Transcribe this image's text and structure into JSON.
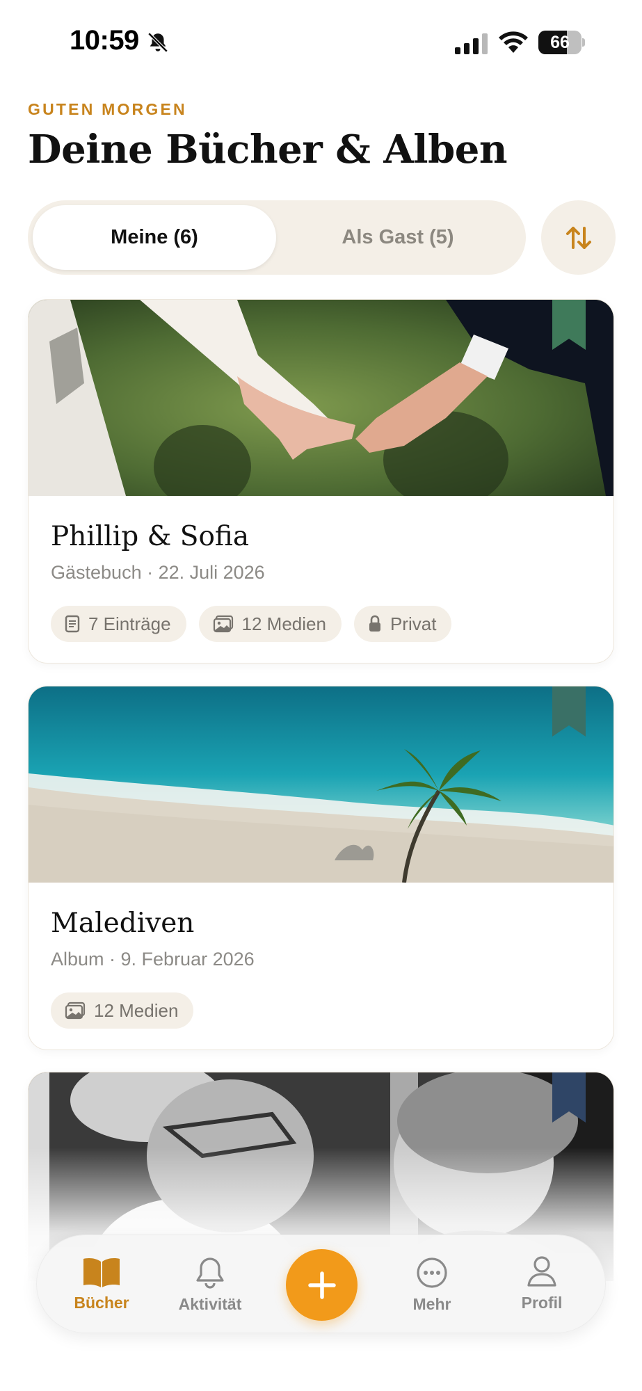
{
  "status_bar": {
    "time": "10:59",
    "battery_percent": "66",
    "battery_level": 0.66,
    "icons": [
      "bell-slash-icon",
      "cellular-signal-icon",
      "wifi-icon",
      "battery-icon"
    ]
  },
  "header": {
    "greeting": "GUTEN MORGEN",
    "title": "Deine Bücher & Alben"
  },
  "segments": {
    "active_label": "Meine (6)",
    "inactive_label": "Als Gast (5)",
    "sort_icon": "sort-arrows-icon"
  },
  "cards": [
    {
      "title": "Phillip & Sofia",
      "subtitle": "Gästebuch · 22. Juli 2026",
      "cover": "wedding couple holding hands",
      "ribbon_color": "#3f7a5a",
      "chips": [
        {
          "icon": "entries-icon",
          "label": "7 Einträge"
        },
        {
          "icon": "media-icon",
          "label": "12 Medien"
        },
        {
          "icon": "lock-icon",
          "label": "Privat"
        }
      ]
    },
    {
      "title": "Malediven",
      "subtitle": "Album · 9. Februar 2026",
      "cover": "beach with palm tree",
      "ribbon_color": "#3a7066",
      "chips": [
        {
          "icon": "media-icon",
          "label": "12 Medien"
        }
      ]
    },
    {
      "title": "",
      "subtitle": "",
      "cover": "elderly couple black and white photo",
      "ribbon_color": "#2f4566",
      "chips": []
    }
  ],
  "tab_bar": {
    "tabs": [
      {
        "icon": "book-icon",
        "label": "Bücher",
        "active": true
      },
      {
        "icon": "bell-icon",
        "label": "Aktivität",
        "active": false
      },
      {
        "icon": "plus-icon",
        "label": "",
        "active": false
      },
      {
        "icon": "more-icon",
        "label": "Mehr",
        "active": false
      },
      {
        "icon": "person-icon",
        "label": "Profil",
        "active": false
      }
    ]
  },
  "colors": {
    "accent": "#c8841d",
    "fab": "#f29a1a",
    "chip_bg": "#f4efe7",
    "segment_bg": "#f4efe7"
  }
}
